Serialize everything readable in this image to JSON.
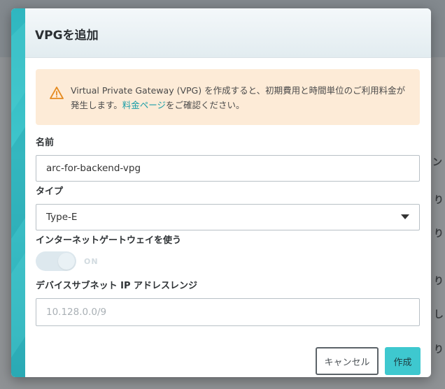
{
  "background": {
    "right_text_1": "ン",
    "right_text_2": "り",
    "right_text_3": "り",
    "right_text_4": "り",
    "right_text_5": "し",
    "right_text_6": "り"
  },
  "modal": {
    "title": "VPGを追加",
    "alert": {
      "icon": "warning-triangle-icon",
      "text_before": "Virtual Private Gateway (VPG) を作成すると、初期費用と時間単位のご利用料金が発生します。",
      "link_text": "料金ページ",
      "text_after": "をご確認ください。",
      "color": "#fdebd7"
    },
    "fields": {
      "name_label": "名前",
      "name_value": "arc-for-backend-vpg",
      "type_label": "タイプ",
      "type_value": "Type-E",
      "gateway_label": "インターネットゲートウェイを使う",
      "gateway_toggle_text": "ON",
      "subnet_label": "デバイスサブネット IP アドレスレンジ",
      "subnet_placeholder": "10.128.0.0/9"
    },
    "buttons": {
      "cancel_label": "キャンセル",
      "create_label": "作成"
    },
    "accent_color": "#3ec8cf"
  }
}
